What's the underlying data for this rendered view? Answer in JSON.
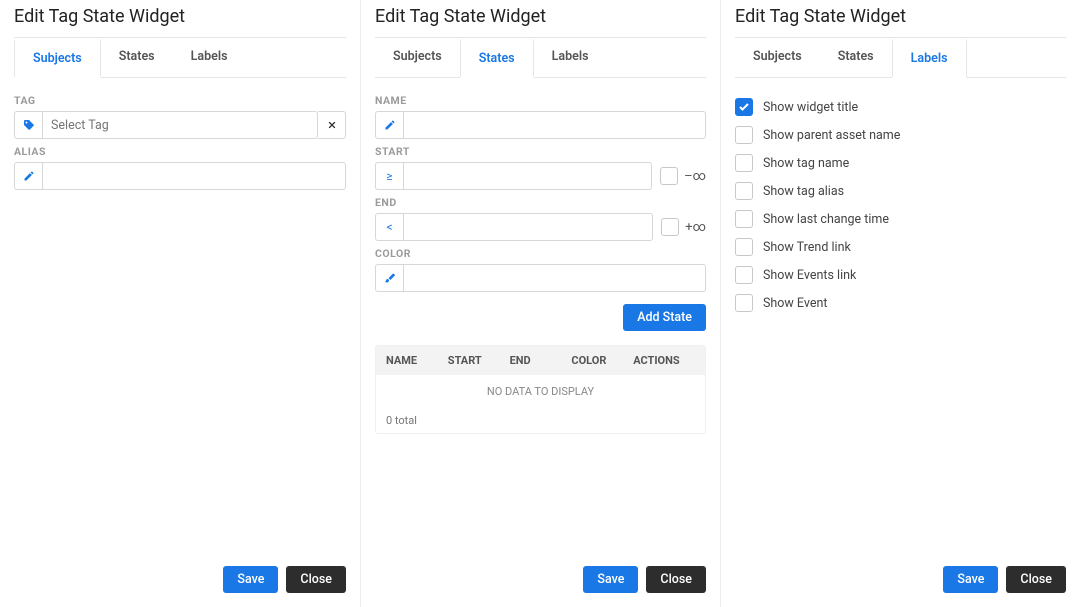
{
  "panels": [
    {
      "title": "Edit Tag State Widget",
      "tabs": [
        "Subjects",
        "States",
        "Labels"
      ],
      "active_tab": "Subjects",
      "fields": {
        "tag_label": "TAG",
        "tag_placeholder": "Select Tag",
        "alias_label": "ALIAS"
      },
      "save": "Save",
      "close": "Close"
    },
    {
      "title": "Edit Tag State Widget",
      "tabs": [
        "Subjects",
        "States",
        "Labels"
      ],
      "active_tab": "States",
      "fields": {
        "name_label": "NAME",
        "start_label": "START",
        "start_prefix": "≥",
        "start_inf": "–∞",
        "end_label": "END",
        "end_prefix": "<",
        "end_inf": "+∞",
        "color_label": "COLOR",
        "add_btn": "Add State",
        "table_headers": [
          "NAME",
          "START",
          "END",
          "COLOR",
          "ACTIONS"
        ],
        "empty_msg": "NO DATA TO DISPLAY",
        "total": "0 total"
      },
      "save": "Save",
      "close": "Close"
    },
    {
      "title": "Edit Tag State Widget",
      "tabs": [
        "Subjects",
        "States",
        "Labels"
      ],
      "active_tab": "Labels",
      "checks": [
        {
          "label": "Show widget title",
          "checked": true
        },
        {
          "label": "Show parent asset name",
          "checked": false
        },
        {
          "label": "Show tag name",
          "checked": false
        },
        {
          "label": "Show tag alias",
          "checked": false
        },
        {
          "label": "Show last change time",
          "checked": false
        },
        {
          "label": "Show Trend link",
          "checked": false
        },
        {
          "label": "Show Events link",
          "checked": false
        },
        {
          "label": "Show Event",
          "checked": false
        }
      ],
      "save": "Save",
      "close": "Close"
    }
  ]
}
